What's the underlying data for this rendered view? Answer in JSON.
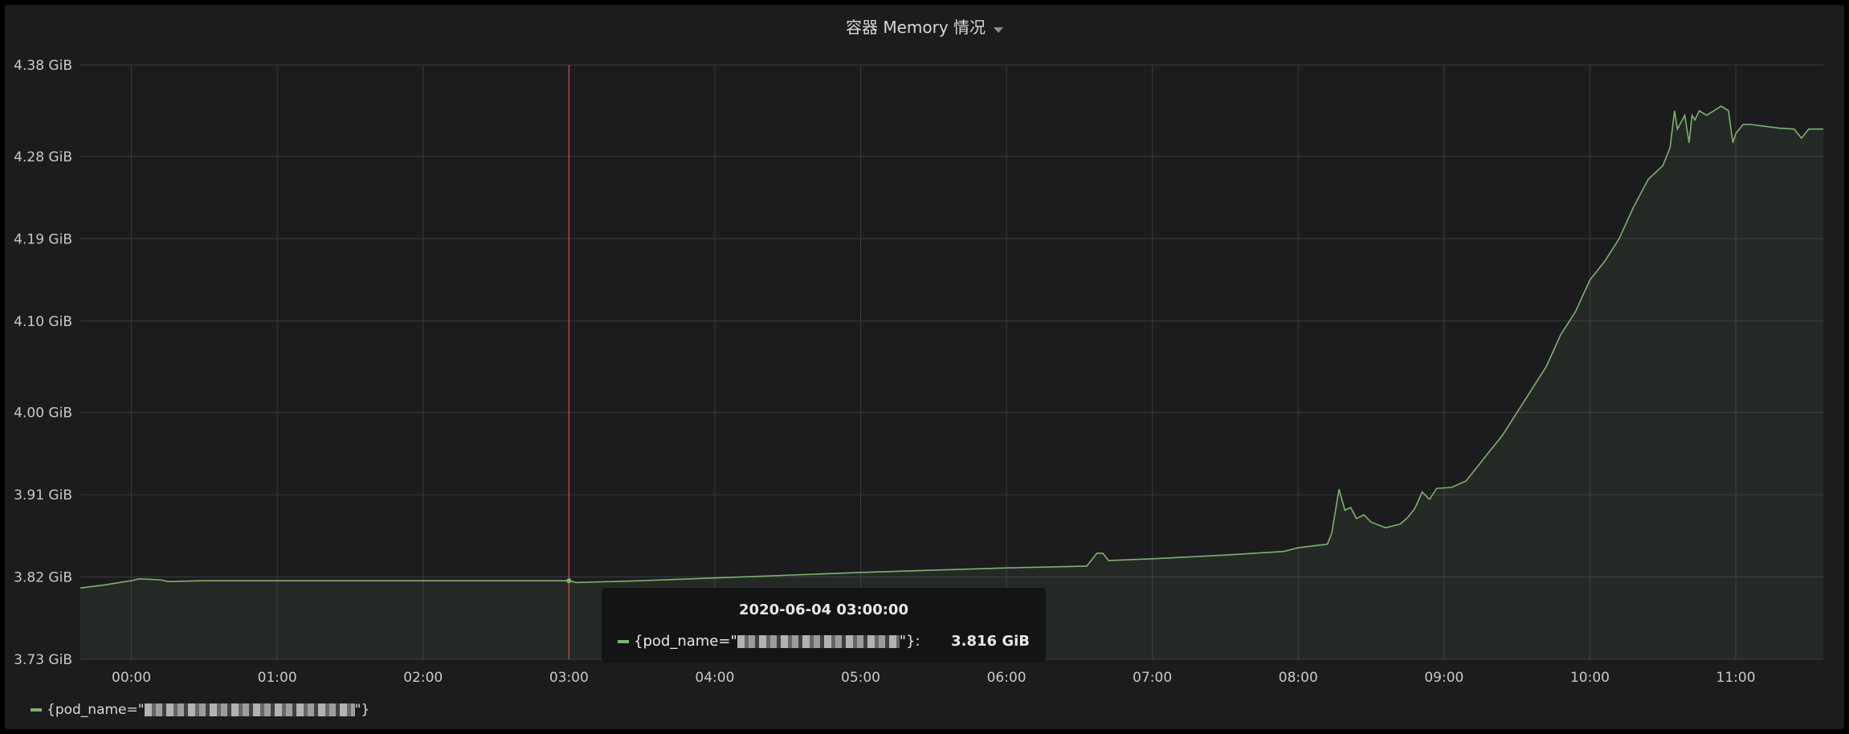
{
  "panel": {
    "title": "容器 Memory 情况"
  },
  "tooltip": {
    "time": "2020-06-04 03:00:00",
    "series_prefix": "{pod_name=\"",
    "series_suffix": "\"}:",
    "value": "3.816 GiB"
  },
  "legend": {
    "series_prefix": "{pod_name=\"",
    "series_suffix": "\"}"
  },
  "colors": {
    "series": "#7eb26d",
    "cursor": "#e24d42",
    "grid": "#3a3b3e",
    "panel_bg": "#1c1c1f"
  },
  "chart_data": {
    "type": "line",
    "fill": "area",
    "ylim": [
      3.73,
      4.38
    ],
    "yticks": [
      "3.73 GiB",
      "3.82 GiB",
      "3.91 GiB",
      "4.00 GiB",
      "4.10 GiB",
      "4.19 GiB",
      "4.28 GiB",
      "4.38 GiB"
    ],
    "ytick_values": [
      3.73,
      3.82,
      3.91,
      4.0,
      4.1,
      4.19,
      4.28,
      4.38
    ],
    "xlim": [
      -0.35,
      11.6
    ],
    "xticks": [
      "00:00",
      "01:00",
      "02:00",
      "03:00",
      "04:00",
      "05:00",
      "06:00",
      "07:00",
      "08:00",
      "09:00",
      "10:00",
      "11:00"
    ],
    "xtick_values": [
      0,
      1,
      2,
      3,
      4,
      5,
      6,
      7,
      8,
      9,
      10,
      11
    ],
    "cursor_x": 3.0,
    "series": [
      {
        "x": [
          -0.35,
          -0.2,
          0.0,
          0.05,
          0.2,
          0.25,
          0.5,
          1.0,
          1.5,
          2.0,
          2.5,
          3.0,
          3.05,
          3.5,
          4.0,
          5.0,
          6.0,
          6.55,
          6.62,
          6.66,
          6.7,
          7.0,
          7.5,
          7.9,
          8.0,
          8.2,
          8.23,
          8.28,
          8.32,
          8.36,
          8.4,
          8.45,
          8.5,
          8.6,
          8.7,
          8.75,
          8.8,
          8.85,
          8.9,
          8.95,
          9.05,
          9.15,
          9.2,
          9.3,
          9.4,
          9.5,
          9.6,
          9.7,
          9.8,
          9.9,
          10.0,
          10.1,
          10.2,
          10.3,
          10.4,
          10.5,
          10.55,
          10.58,
          10.6,
          10.65,
          10.68,
          10.7,
          10.72,
          10.75,
          10.8,
          10.9,
          10.95,
          10.98,
          11.0,
          11.05,
          11.1,
          11.2,
          11.3,
          11.4,
          11.45,
          11.5,
          11.6
        ],
        "y": [
          3.808,
          3.811,
          3.816,
          3.818,
          3.817,
          3.815,
          3.816,
          3.816,
          3.816,
          3.816,
          3.816,
          3.816,
          3.814,
          3.816,
          3.819,
          3.825,
          3.83,
          3.832,
          3.846,
          3.846,
          3.838,
          3.84,
          3.844,
          3.848,
          3.852,
          3.856,
          3.868,
          3.916,
          3.893,
          3.896,
          3.884,
          3.888,
          3.88,
          3.874,
          3.878,
          3.885,
          3.895,
          3.913,
          3.905,
          3.917,
          3.918,
          3.925,
          3.935,
          3.955,
          3.975,
          4.0,
          4.025,
          4.05,
          4.085,
          4.11,
          4.145,
          4.165,
          4.19,
          4.225,
          4.255,
          4.27,
          4.29,
          4.33,
          4.31,
          4.325,
          4.295,
          4.325,
          4.32,
          4.33,
          4.325,
          4.335,
          4.33,
          4.295,
          4.305,
          4.315,
          4.315,
          4.313,
          4.311,
          4.31,
          4.3,
          4.31,
          4.31
        ]
      }
    ]
  }
}
